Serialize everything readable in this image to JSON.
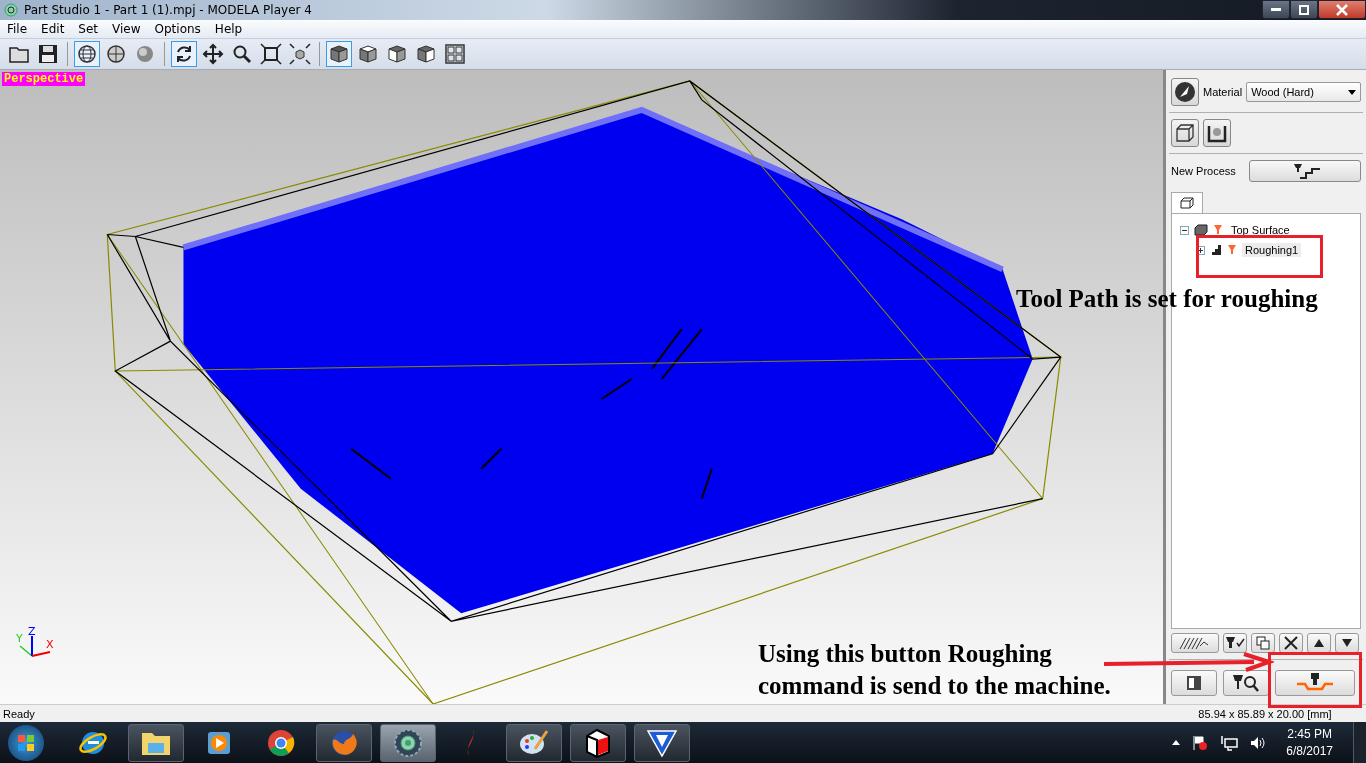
{
  "window": {
    "title": "Part Studio 1 - Part 1 (1).mpj - MODELA Player 4"
  },
  "menu": [
    "File",
    "Edit",
    "Set",
    "View",
    "Options",
    "Help"
  ],
  "toolbar": [
    {
      "kind": "open",
      "selected": false
    },
    {
      "kind": "save",
      "selected": false
    },
    {
      "kind": "separator"
    },
    {
      "kind": "wireframe",
      "selected": true
    },
    {
      "kind": "section",
      "selected": false
    },
    {
      "kind": "shaded",
      "selected": false
    },
    {
      "kind": "separator"
    },
    {
      "kind": "rotate",
      "selected": true
    },
    {
      "kind": "pan",
      "selected": false
    },
    {
      "kind": "zoom",
      "selected": false
    },
    {
      "kind": "fit",
      "selected": false
    },
    {
      "kind": "fit-selection",
      "selected": false
    },
    {
      "kind": "separator"
    },
    {
      "kind": "view-iso",
      "selected": true
    },
    {
      "kind": "view-top",
      "selected": false
    },
    {
      "kind": "view-front",
      "selected": false
    },
    {
      "kind": "view-right",
      "selected": false
    },
    {
      "kind": "layout",
      "selected": false
    }
  ],
  "viewport": {
    "label": "Perspective",
    "axes": {
      "x": "X",
      "y": "Y",
      "z": "Z"
    }
  },
  "panel": {
    "material_label": "Material",
    "material": "Wood (Hard)",
    "new_process_label": "New Process",
    "tree": [
      {
        "label": "Top Surface",
        "expanded": true,
        "children": [
          {
            "label": "Roughing1",
            "expanded": false
          }
        ]
      }
    ]
  },
  "status_bar": {
    "message": "Ready",
    "dimensions": "85.94 x 85.89 x 20.00 [mm]"
  },
  "taskbar": {
    "time": "2:45 PM",
    "date": "6/8/2017"
  },
  "annotations": {
    "tree_note": "Tool Path is set for roughing",
    "button_note": [
      "Using this button Roughing",
      "command is send to the machine."
    ]
  }
}
